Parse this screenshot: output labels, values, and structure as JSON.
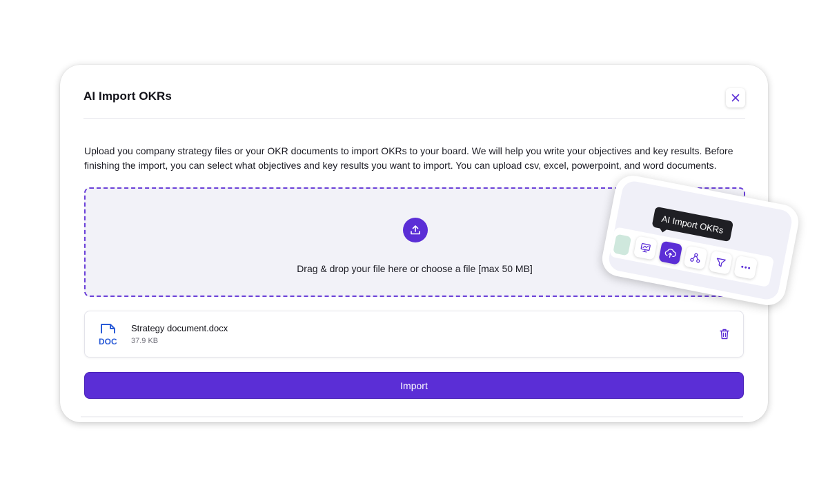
{
  "modal": {
    "title": "AI Import OKRs",
    "close_icon": "close-icon",
    "description": "Upload you company strategy files or your OKR documents to import OKRs to your board. We will help you write your objectives and key results. Before finishing the import, you can select what objectives and key results you want to import. You can upload csv, excel, powerpoint, and word documents.",
    "dropzone": {
      "icon": "upload-icon",
      "text": "Drag & drop your file here or choose a file [max 50 MB]"
    },
    "file": {
      "icon": "doc-file-icon",
      "icon_label": "DOC",
      "name": "Strategy document.docx",
      "size": "37.9 KB",
      "delete_icon": "trash-icon"
    },
    "import_label": "Import"
  },
  "callout": {
    "tooltip": "AI Import OKRs",
    "tools": [
      {
        "icon": "presentation-icon",
        "active": false
      },
      {
        "icon": "cloud-upload-icon",
        "active": true
      },
      {
        "icon": "hierarchy-icon",
        "active": false
      },
      {
        "icon": "filter-icon",
        "active": false
      },
      {
        "icon": "more-icon",
        "active": false
      }
    ]
  },
  "colors": {
    "accent": "#5b2ed6",
    "doc_blue": "#2a5bd7",
    "tooltip_bg": "#1f1f24",
    "dropzone_bg": "#f2f2f8"
  }
}
